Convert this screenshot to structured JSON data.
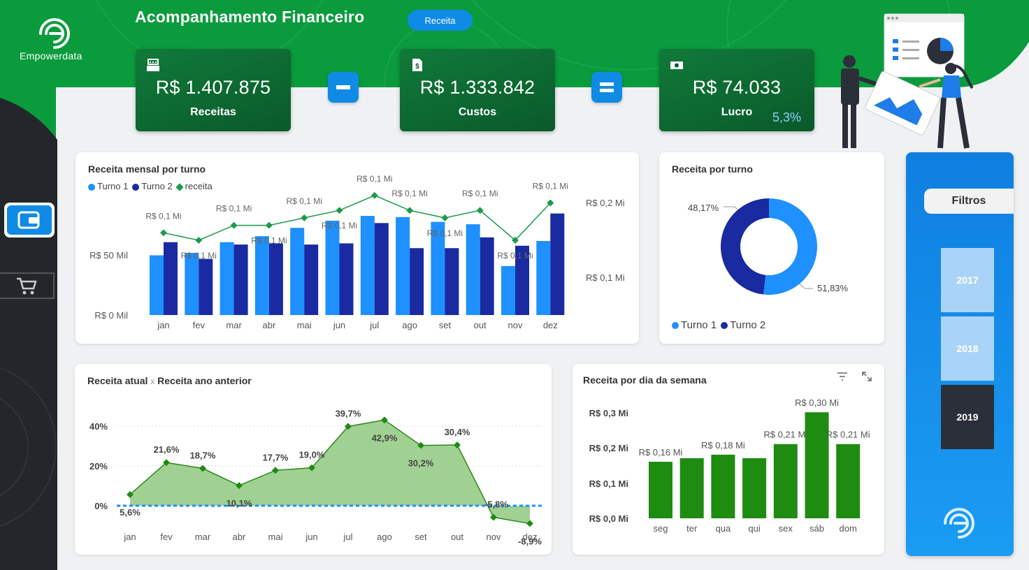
{
  "brand": {
    "logo_text": "Empowerdata"
  },
  "header": {
    "title": "Acompanhamento Financeiro",
    "pill": "Receita"
  },
  "kpis": {
    "revenue": {
      "value": "R$ 1.407.875",
      "label": "Receitas",
      "icon": "cash-register-icon"
    },
    "costs": {
      "value": "R$ 1.333.842",
      "label": "Custos",
      "icon": "invoice-icon"
    },
    "profit": {
      "value": "R$ 74.033",
      "label": "Lucro",
      "margin": "5,3%",
      "icon": "money-icon"
    }
  },
  "operators": {
    "minus": "minus-icon",
    "equals": "equals-icon"
  },
  "colors": {
    "green": "#0a9b3c",
    "blue": "#0f8be6",
    "navy": "#1a2aa0",
    "dark": "#23262b",
    "bar_green": "#1e8c10",
    "area_green": "#8fc97f"
  },
  "monthly_chart": {
    "title": "Receita mensal por turno",
    "legend": [
      "Turno 1",
      "Turno 2",
      "receita"
    ],
    "left_ticks": [
      "R$ 50 Mil",
      "R$ 0 Mil"
    ],
    "right_ticks": [
      "R$ 0,2 Mi",
      "R$ 0,1 Mi"
    ]
  },
  "donut_chart": {
    "title": "Receita por turno",
    "label_turno2": "48,17%",
    "label_turno1": "51,83%",
    "legend": [
      "Turno 1",
      "Turno 2"
    ]
  },
  "area_chart": {
    "title_a": "Receita atual",
    "title_sep": "x",
    "title_b": "Receita ano anterior"
  },
  "weekday_chart": {
    "title": "Receita por dia da semana",
    "filter_icon": "filter-icon",
    "expand_icon": "expand-icon"
  },
  "filters": {
    "title": "Filtros",
    "years": [
      "2017",
      "2018",
      "2019"
    ],
    "selected": "2019"
  },
  "nav": {
    "items": [
      "wallet-icon",
      "cart-icon"
    ]
  },
  "chart_data": [
    {
      "type": "bar",
      "title": "Receita mensal por turno",
      "categories": [
        "jan",
        "fev",
        "mar",
        "abr",
        "mai",
        "jun",
        "jul",
        "ago",
        "set",
        "out",
        "nov",
        "dez"
      ],
      "series": [
        {
          "name": "Turno 1",
          "values": [
            50,
            52,
            61,
            66,
            73,
            79,
            83,
            82,
            78,
            76,
            41,
            62
          ]
        },
        {
          "name": "Turno 2",
          "values": [
            61,
            47,
            59,
            60,
            59,
            60,
            77,
            56,
            56,
            65,
            58,
            85
          ]
        },
        {
          "name": "receita",
          "values": [
            0.11,
            0.1,
            0.12,
            0.12,
            0.13,
            0.14,
            0.16,
            0.14,
            0.13,
            0.14,
            0.1,
            0.15
          ],
          "axis": "right"
        }
      ],
      "data_labels": [
        "R$ 0,1 Mi",
        "R$ 0,1 Mi",
        "R$ 0,1 Mi",
        "R$ 0,1 Mi",
        "R$ 0,1 Mi",
        "R$ 0,1 Mi",
        "R$ 0,1 Mi",
        "R$ 0,1 Mi",
        "R$ 0,1 Mi",
        "R$ 0,1 Mi",
        "R$ 0,1 Mi",
        "R$ 0,1 Mi"
      ],
      "ylim": [
        0,
        100
      ],
      "ylim_right": [
        0,
        0.2
      ]
    },
    {
      "type": "pie",
      "title": "Receita por turno",
      "categories": [
        "Turno 1",
        "Turno 2"
      ],
      "values": [
        51.83,
        48.17
      ]
    },
    {
      "type": "area",
      "title": "Receita atual x Receita ano anterior",
      "categories": [
        "jan",
        "fev",
        "mar",
        "abr",
        "mai",
        "jun",
        "jul",
        "ago",
        "set",
        "out",
        "nov",
        "dez"
      ],
      "values": [
        5.6,
        21.6,
        18.7,
        10.1,
        17.7,
        19.0,
        39.7,
        42.9,
        30.2,
        30.4,
        -5.8,
        -8.9
      ],
      "labels": [
        "5,6%",
        "21,6%",
        "18,7%",
        "10,1%",
        "17,7%",
        "19,0%",
        "39,7%",
        "42,9%",
        "30,2%",
        "30,4%",
        "-5,8%",
        "-8,9%"
      ],
      "y_ticks": [
        "40%",
        "20%",
        "0%"
      ],
      "ylim": [
        -10,
        50
      ]
    },
    {
      "type": "bar",
      "title": "Receita por dia da semana",
      "categories": [
        "seg",
        "ter",
        "qua",
        "qui",
        "sex",
        "sáb",
        "dom"
      ],
      "values": [
        0.16,
        0.17,
        0.18,
        0.17,
        0.21,
        0.3,
        0.21
      ],
      "labels": [
        "R$ 0,16 Mi",
        "",
        "R$ 0,18 Mi",
        "",
        "R$ 0,21 Mi",
        "R$ 0,30 Mi",
        "R$ 0,21 Mi"
      ],
      "y_ticks": [
        "R$ 0,3 Mi",
        "R$ 0,2 Mi",
        "R$ 0,1 Mi",
        "R$ 0,0 Mi"
      ],
      "ylim": [
        0,
        0.3
      ]
    }
  ]
}
